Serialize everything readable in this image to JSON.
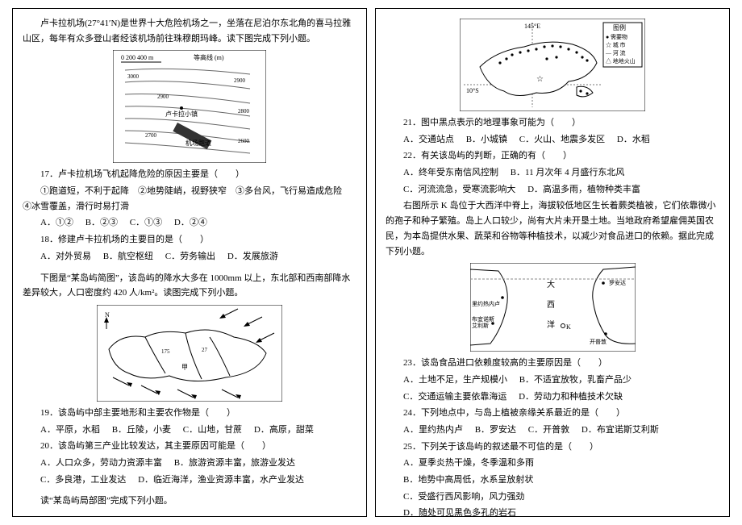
{
  "left": {
    "intro17": "卢卡拉机场(27°41′N)是世界十大危险机场之一，坐落在尼泊尔东北角的喜马拉雅山区，每年有众多登山者经该机场前往珠穆朗玛峰。读下图完成下列小题。",
    "fig1_scale": "0  200  400 m",
    "fig1_contour": "等高线 (m)",
    "fig1_place": "卢卡拉小镇",
    "fig1_runway": "机场跑道",
    "q17": "17．卢卡拉机场飞机起降危险的原因主要是（　　）",
    "q17_reasons": "①跑道短，不利于起降　②地势陡峭，视野狭窄　③多台风，飞行易造成危险　④冰雪覆盖，滑行时易打滑",
    "q17_opts": {
      "A": "A．①②",
      "B": "B．②③",
      "C": "C．①③",
      "D": "D．②④"
    },
    "q18": "18．修建卢卡拉机场的主要目的是（　　）",
    "q18_opts": {
      "A": "A．对外贸易",
      "B": "B．航空枢纽",
      "C": "C．劳务输出",
      "D": "D．发展旅游"
    },
    "intro19": "下图是“某岛屿简图”，该岛屿的降水大多在 1000mm 以上，东北部和西南部降水差异较大，人口密度约 420 人/km²。读图完成下列小题。",
    "q19": "19．该岛屿中部主要地形和主要农作物是（　　）",
    "q19_opts": {
      "A": "A．平原，水稻",
      "B": "B．丘陵，小麦",
      "C": "C．山地，甘蔗",
      "D": "D．高原，甜菜"
    },
    "q20": "20．该岛屿第三产业比较发达，其主要原因可能是（　　）",
    "q20_opts": {
      "A": "A．人口众多，劳动力资源丰富",
      "B": "B．旅游资源丰富，旅游业发达",
      "C": "C．多良港，工业发达",
      "D": "D．临近海洋，渔业资源丰富，水产业发达"
    },
    "intro21_footer": "读“某岛屿局部图”完成下列小题。"
  },
  "right": {
    "fig3_lon": "145°E",
    "fig3_lat": "10°S",
    "fig3_legend_title": "图例",
    "fig3_leg1": "● 需要物",
    "fig3_leg2": "☆ 城 市",
    "fig3_leg3": "— 河 流",
    "fig3_leg4": "△ 地地火山",
    "q21": "21．图中黑点表示的地理事象可能为（　　）",
    "q21_opts": {
      "A": "A．交通站点",
      "B": "B．小城镇",
      "C": "C．火山、地震多发区",
      "D": "D．水稻"
    },
    "q22": "22．有关该岛屿的判断，正确的有（　　）",
    "q22_opts": {
      "A": "A．终年受东南信风控制",
      "B": "B．11 月次年 4 月盛行东北风",
      "C": "C．河流流急，受寒流影响大",
      "D": "D．高温多雨，植物种类丰富"
    },
    "intro23": "右图所示 K 岛位于大西洋中脊上，海拔较低地区生长着蕨类植被，它们依靠微小的孢子和种子繁殖。岛上人口较少，尚有大片未开垦土地。当地政府希望雇佣英国农民，为本岛提供水果、蔬菜和谷物等种植技术，以减少对食品进口的依赖。据此完成下列小题。",
    "fig4_ocean_top": "大",
    "fig4_ocean_mid": "西",
    "fig4_ocean_bot": "洋",
    "fig4_rio": "里约热内卢",
    "fig4_bue": "布宜诺斯",
    "fig4_bue2": "艾利斯",
    "fig4_cape": "开普敦",
    "fig4_luo": "罗安达",
    "fig4_k": "K",
    "q23": "23．该岛食品进口依赖度较高的主要原因是（　　）",
    "q23_opts": {
      "A": "A．土地不足，生产规模小",
      "B": "B．不适宜放牧，乳畜产品少",
      "C": "C．交通运输主要依靠海运",
      "D": "D．劳动力和种植技术欠缺"
    },
    "q24": "24．下列地点中，与岛上植被亲缘关系最近的是（　　）",
    "q24_opts": {
      "A": "A．里约热内卢",
      "B": "B．罗安达",
      "C": "C．开普敦",
      "D": "D．布宜诺斯艾利斯"
    },
    "q25": "25．下列关于该岛屿的叙述最不可信的是（　　）",
    "q25_A": "A．夏季炎热干燥，冬季温和多雨",
    "q25_B": "B．地势中高周低，水系呈放射状",
    "q25_C": "C．受盛行西风影响，风力强劲",
    "q25_D": "D．随处可见黑色多孔的岩石"
  }
}
